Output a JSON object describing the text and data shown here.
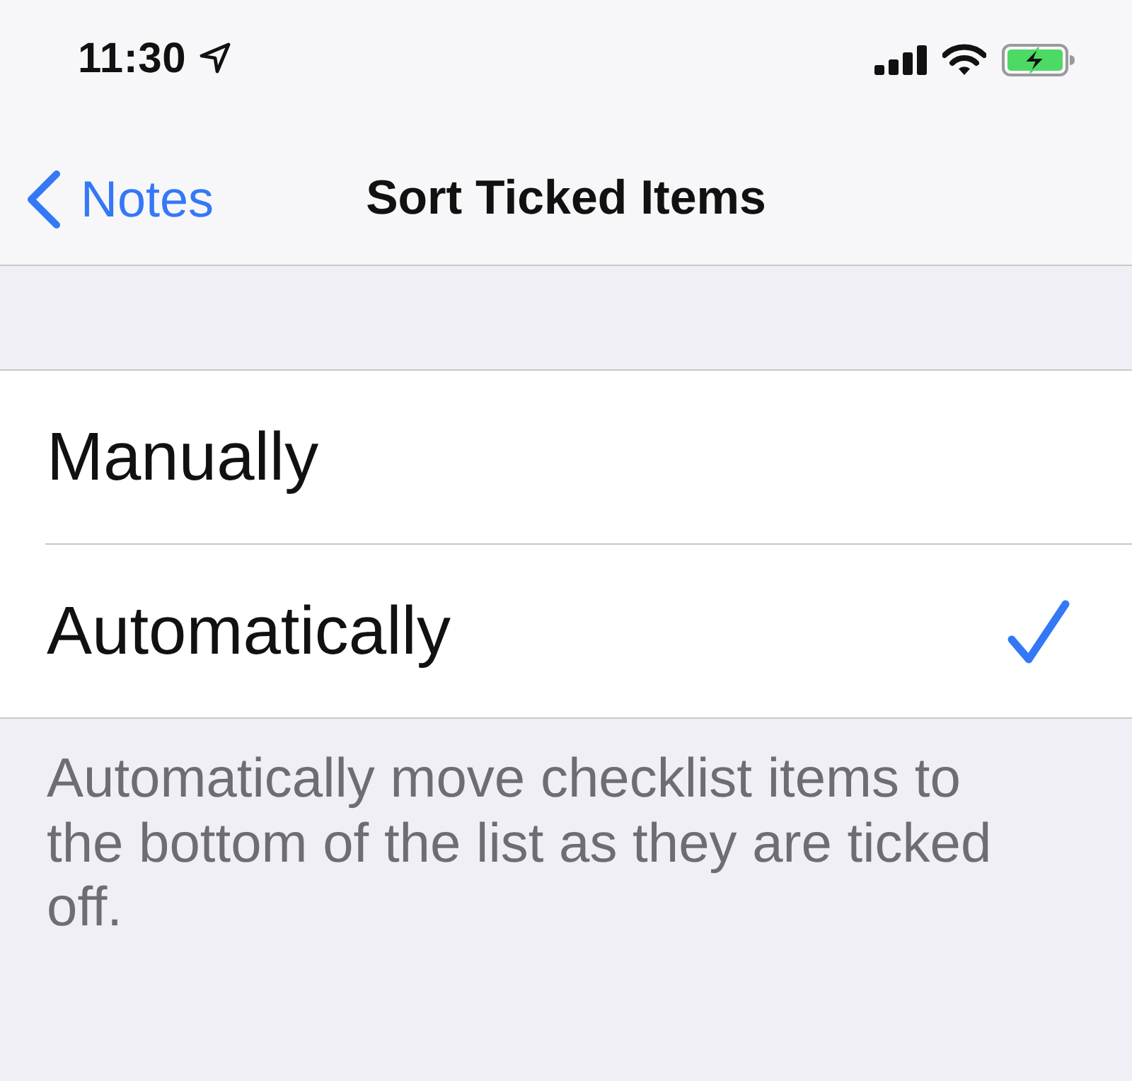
{
  "status_bar": {
    "time": "11:30"
  },
  "nav_bar": {
    "back_label": "Notes",
    "title": "Sort Ticked Items"
  },
  "options": [
    {
      "label": "Manually",
      "selected": false
    },
    {
      "label": "Automatically",
      "selected": true
    }
  ],
  "footer": "Automatically move checklist items to the bottom of the list as they are ticked off."
}
